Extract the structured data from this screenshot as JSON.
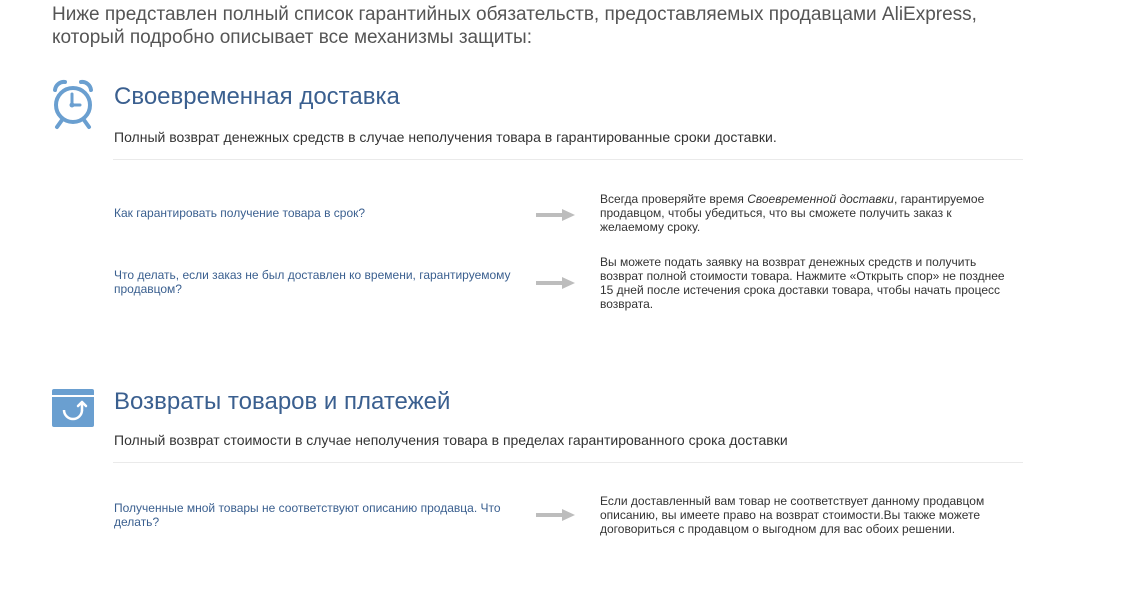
{
  "intro_text": "Ниже представлен полный список гарантийных обязательств, предоставляемых продавцами AliExpress, который подробно описывает все механизмы защиты:",
  "colors": {
    "accent_blue": "#3a5f8f",
    "icon_blue": "#6a9fd0",
    "arrow_gray": "#bdbdbd"
  },
  "sections": [
    {
      "icon": "alarm-clock-icon",
      "title": "Своевременная доставка",
      "description": "Полный возврат денежных средств в случае неполучения товара в гарантированные сроки доставки.",
      "faq": [
        {
          "question": "Как гарантировать получение товара в срок?",
          "answer_before": "Всегда проверяйте время ",
          "answer_emph": "Своевременной доставки",
          "answer_after": ", гарантируемое продавцом, чтобы убедиться, что вы сможете получить заказ к желаемому сроку."
        },
        {
          "question": "Что делать, если заказ не был доставлен ко времени, гарантируемому продавцом?",
          "answer": "Вы можете подать заявку на возврат денежных средств и получить возврат полной стоимости товара. Нажмите «Открыть спор» не позднее 15 дней после истечения срока доставки товара, чтобы начать процесс возврата."
        }
      ]
    },
    {
      "icon": "return-box-icon",
      "title": "Возвраты товаров и платежей",
      "description": "Полный возврат стоимости в случае неполучения товара в пределах гарантированного срока доставки",
      "faq": [
        {
          "question": "Полученные мной товары не соответствуют описанию продавца. Что делать?",
          "answer": "Если доставленный вам товар не соответствует данному продавцом описанию, вы имеете право на возврат стоимости.Вы также можете договориться с продавцом о выгодном для вас обоих решении."
        }
      ]
    }
  ]
}
